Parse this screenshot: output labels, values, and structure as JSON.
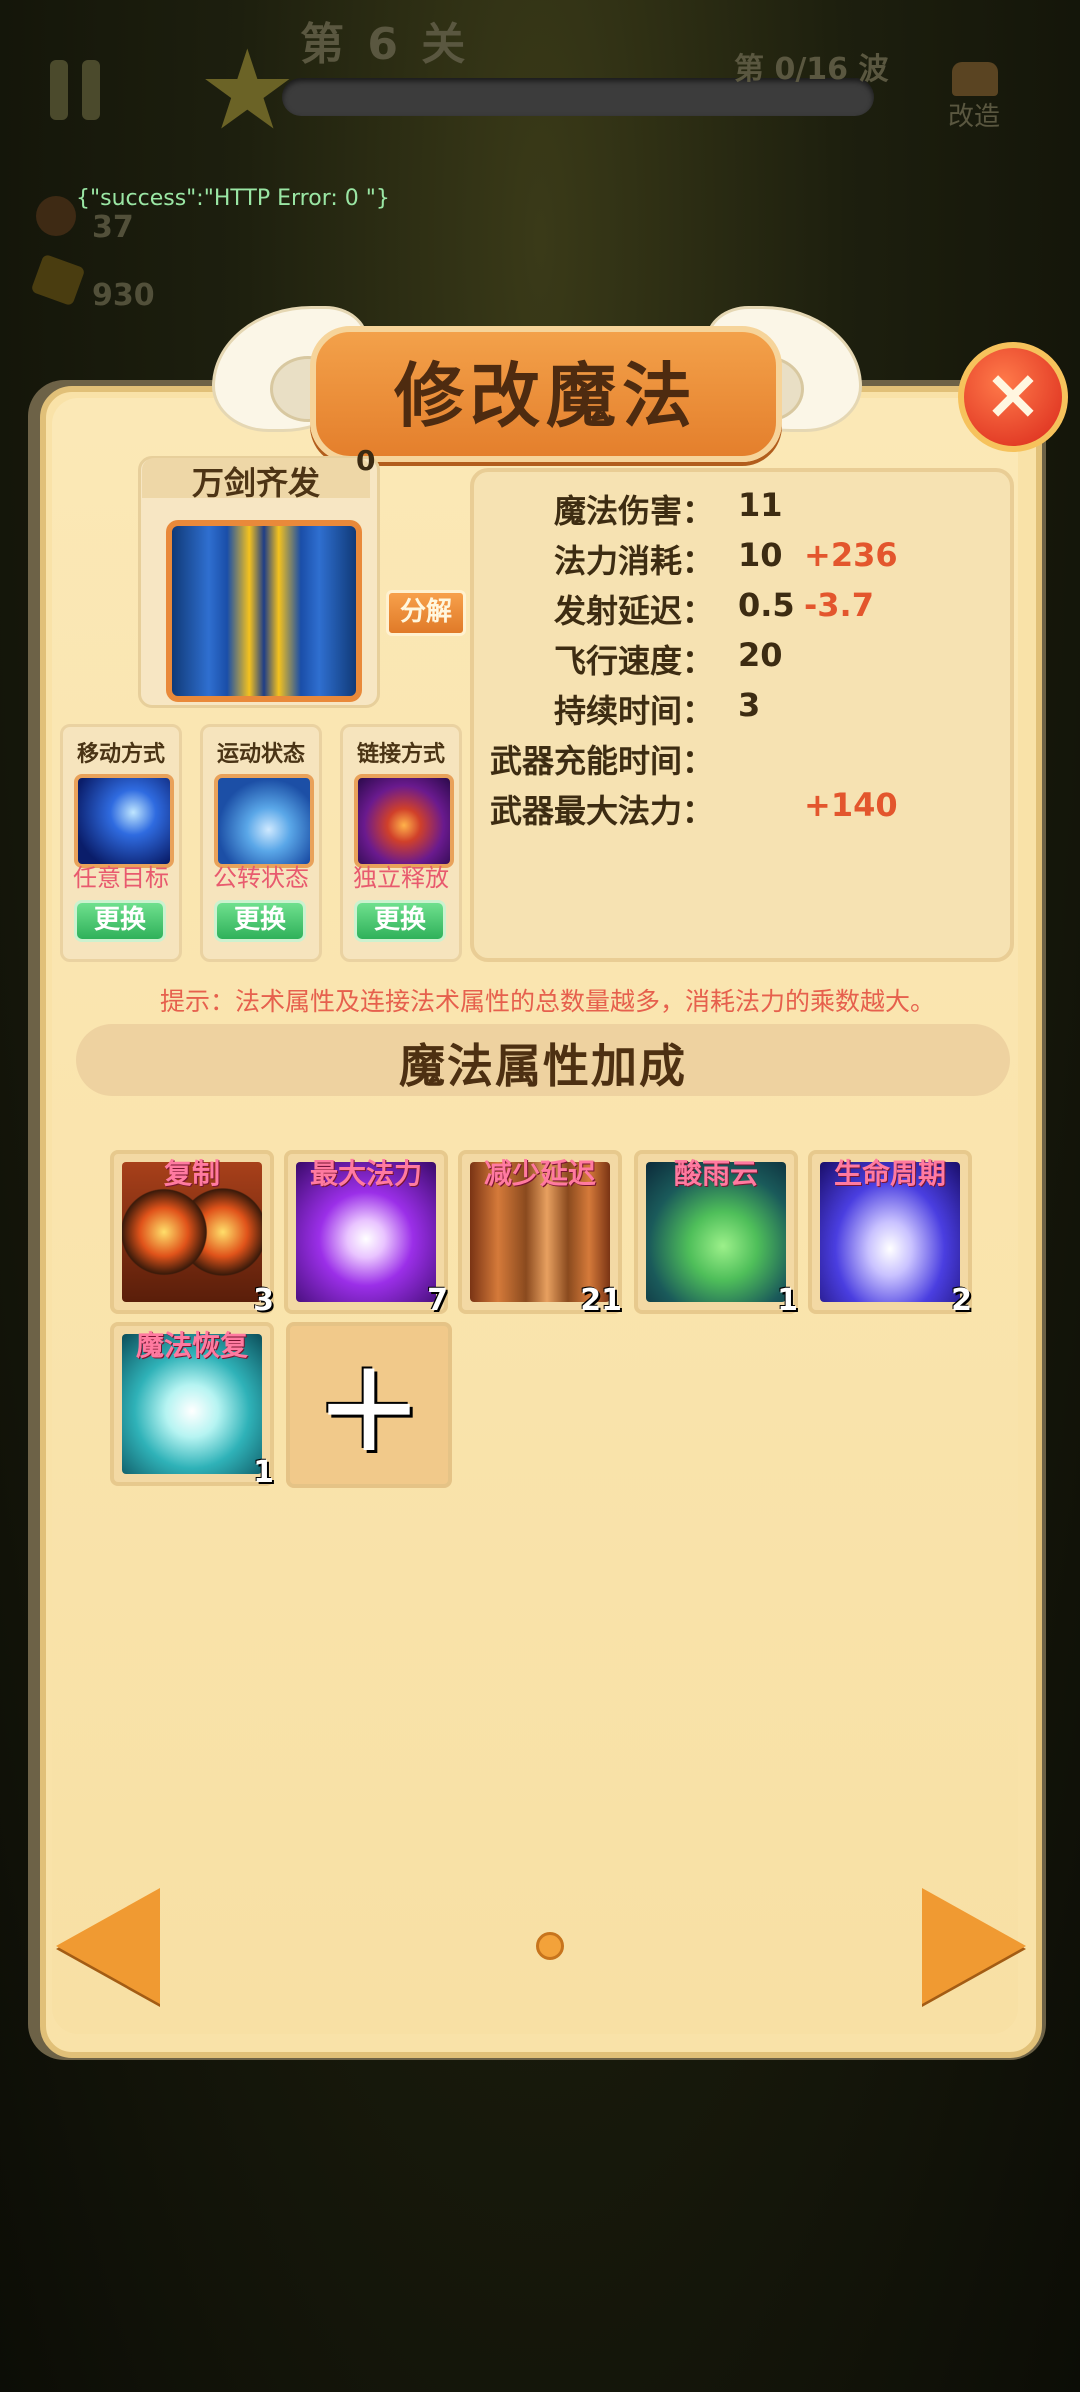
{
  "hud": {
    "level_title": "第 6 关",
    "wave": "第 0/16 波",
    "modify_label": "改造",
    "error_text": "{\"success\":\"HTTP Error: 0 \"}",
    "resource1": "37",
    "resource2": "930"
  },
  "panel": {
    "title": "修改魔法",
    "close_icon": "×"
  },
  "spell": {
    "name": "万剑齐发",
    "count": "0",
    "decompose_label": "分解"
  },
  "slots": [
    {
      "title": "移动方式",
      "value": "任意目标",
      "button": "更换",
      "icon": "comet-icon"
    },
    {
      "title": "运动状态",
      "value": "公转状态",
      "button": "更换",
      "icon": "orbit-clock-icon"
    },
    {
      "title": "链接方式",
      "value": "独立释放",
      "button": "更换",
      "icon": "pentagram-icon"
    }
  ],
  "stats": [
    {
      "label": "魔法伤害：",
      "value": "11",
      "delta": ""
    },
    {
      "label": "法力消耗：",
      "value": "10",
      "delta": "+236"
    },
    {
      "label": "发射延迟：",
      "value": "0.5",
      "delta": "-3.7"
    },
    {
      "label": "飞行速度：",
      "value": "20",
      "delta": ""
    },
    {
      "label": "持续时间：",
      "value": "3",
      "delta": ""
    },
    {
      "label": "武器充能时间：",
      "value": "",
      "delta": ""
    },
    {
      "label": "武器最大法力：",
      "value": "",
      "delta": "+140"
    }
  ],
  "hint": "提示：法术属性及连接法术属性的总数量越多，消耗法力的乘数越大。",
  "section_title": "魔法属性加成",
  "attributes": [
    {
      "name": "复制",
      "count": "3",
      "icon": "duplicate-fire-icon"
    },
    {
      "name": "最大法力",
      "count": "7",
      "icon": "max-mana-cross-icon"
    },
    {
      "name": "减少延迟",
      "count": "21",
      "icon": "hourglass-icon"
    },
    {
      "name": "酸雨云",
      "count": "1",
      "icon": "acid-cloud-icon"
    },
    {
      "name": "生命周期",
      "count": "2",
      "icon": "lifecycle-icon"
    },
    {
      "name": "魔法恢复",
      "count": "1",
      "icon": "mana-restore-icon"
    }
  ],
  "add_symbol": "+",
  "pager": {
    "current_page": 1
  }
}
